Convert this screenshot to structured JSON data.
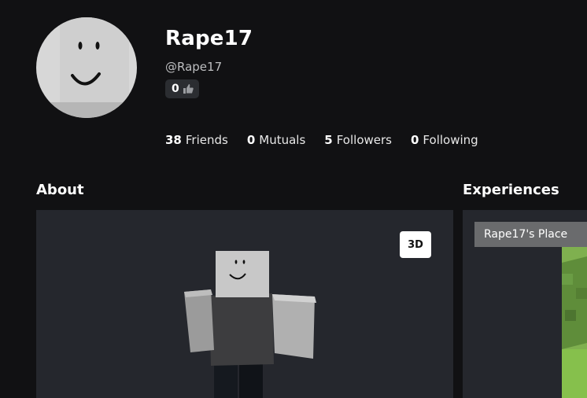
{
  "profile": {
    "display_name": "Rape17",
    "username": "@Rape17",
    "likes_count": "0",
    "icon": "thumbs-up-icon"
  },
  "stats": [
    {
      "value": "38",
      "label": "Friends"
    },
    {
      "value": "0",
      "label": "Mutuals"
    },
    {
      "value": "5",
      "label": "Followers"
    },
    {
      "value": "0",
      "label": "Following"
    }
  ],
  "about": {
    "title": "About",
    "view_toggle": "3D"
  },
  "experiences": {
    "title": "Experiences",
    "items": [
      {
        "name": "Rape17's Place"
      }
    ]
  },
  "colors": {
    "background": "#111113",
    "panel": "#25272d"
  }
}
